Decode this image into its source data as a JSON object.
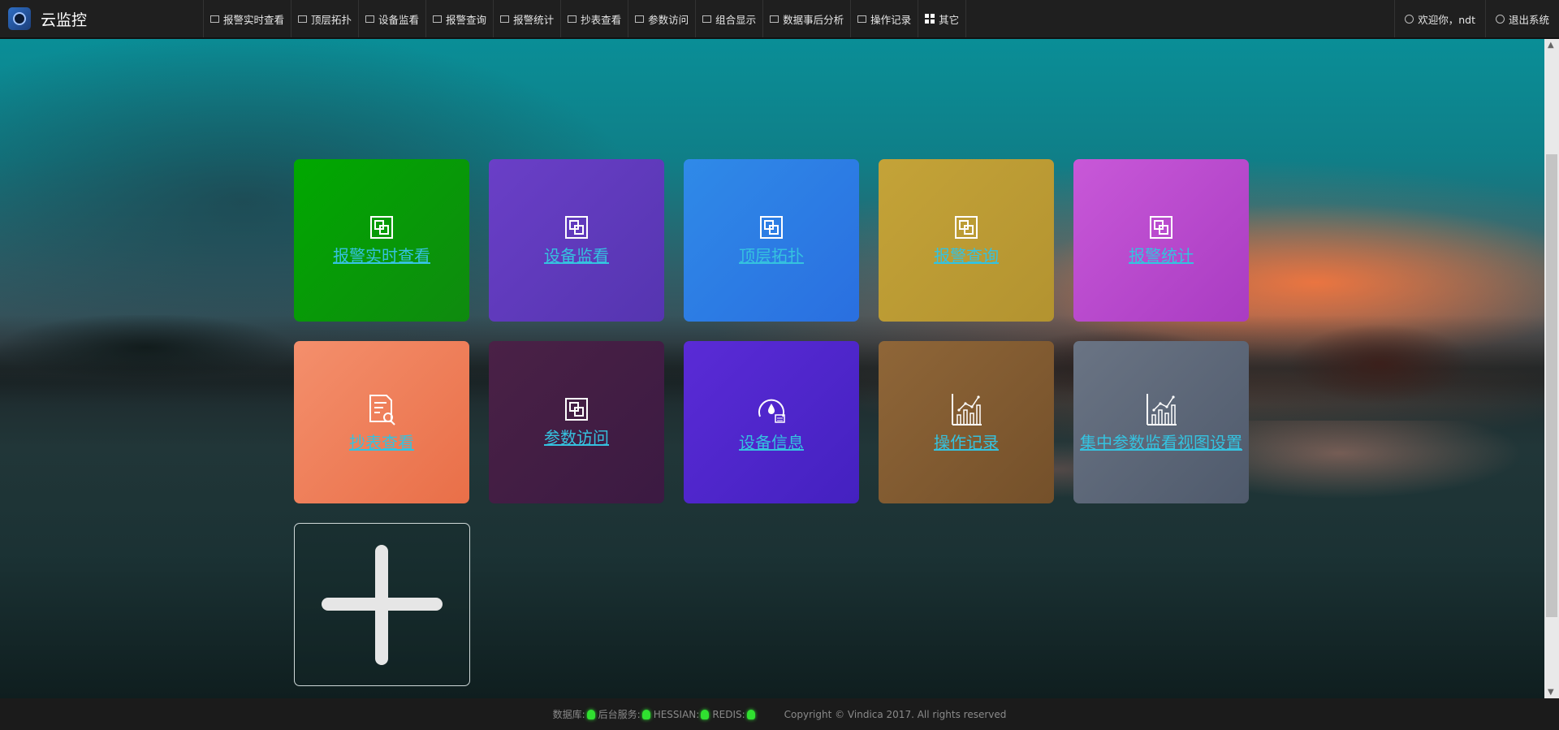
{
  "app": {
    "name": "云监控"
  },
  "nav": {
    "items": [
      {
        "label": "报警实时查看",
        "icon": "monitor-icon"
      },
      {
        "label": "顶层拓扑",
        "icon": "list-icon"
      },
      {
        "label": "设备监看",
        "icon": "list-icon"
      },
      {
        "label": "报警查询",
        "icon": "speaker-icon"
      },
      {
        "label": "报警统计",
        "icon": "line-chart-icon"
      },
      {
        "label": "抄表查看",
        "icon": "table-icon"
      },
      {
        "label": "参数访问",
        "icon": "keyboard-icon"
      },
      {
        "label": "组合显示",
        "icon": "grid-icon"
      },
      {
        "label": "数据事后分析",
        "icon": "bar-chart-icon"
      },
      {
        "label": "操作记录",
        "icon": "list-icon"
      },
      {
        "label": "其它",
        "icon": "apps-icon"
      }
    ],
    "welcome": "欢迎你，ndt",
    "logout": "退出系统"
  },
  "tiles": [
    {
      "label": "报警实时查看",
      "icon": "window-icon",
      "color_from": "#00a800",
      "color_to": "#0f8a0f"
    },
    {
      "label": "设备监看",
      "icon": "window-icon",
      "color_from": "#6a3fc7",
      "color_to": "#5535b0"
    },
    {
      "label": "顶层拓扑",
      "icon": "window-icon",
      "color_from": "#2f8ae8",
      "color_to": "#2a6fe0"
    },
    {
      "label": "报警查询",
      "icon": "window-icon",
      "color_from": "#c4a338",
      "color_to": "#b39330"
    },
    {
      "label": "报警统计",
      "icon": "window-icon",
      "color_from": "#c858d8",
      "color_to": "#a93cc2"
    },
    {
      "label": "抄表查看",
      "icon": "report-search-icon",
      "color_from": "#f48f6c",
      "color_to": "#e96f48"
    },
    {
      "label": "参数访问",
      "icon": "window-icon",
      "color_from": "#4a2146",
      "color_to": "#3b1a42"
    },
    {
      "label": "设备信息",
      "icon": "gauge-icon",
      "color_from": "#5a2bd6",
      "color_to": "#4421c0"
    },
    {
      "label": "操作记录",
      "icon": "bar-chart-icon",
      "color_from": "#8f6638",
      "color_to": "#74502a"
    },
    {
      "label": "集中参数监看视图设置",
      "icon": "bar-chart-icon",
      "color_from": "#6a7484",
      "color_to": "#4f5a6c"
    }
  ],
  "add_tile": {
    "icon": "plus-icon"
  },
  "footer": {
    "db": "数据库:",
    "backend": "后台服务:",
    "hessian": "HESSIAN:",
    "redis": "REDIS:",
    "status_color": "#30e030",
    "copyright": "Copyright © Vindica 2017. All rights reserved"
  }
}
